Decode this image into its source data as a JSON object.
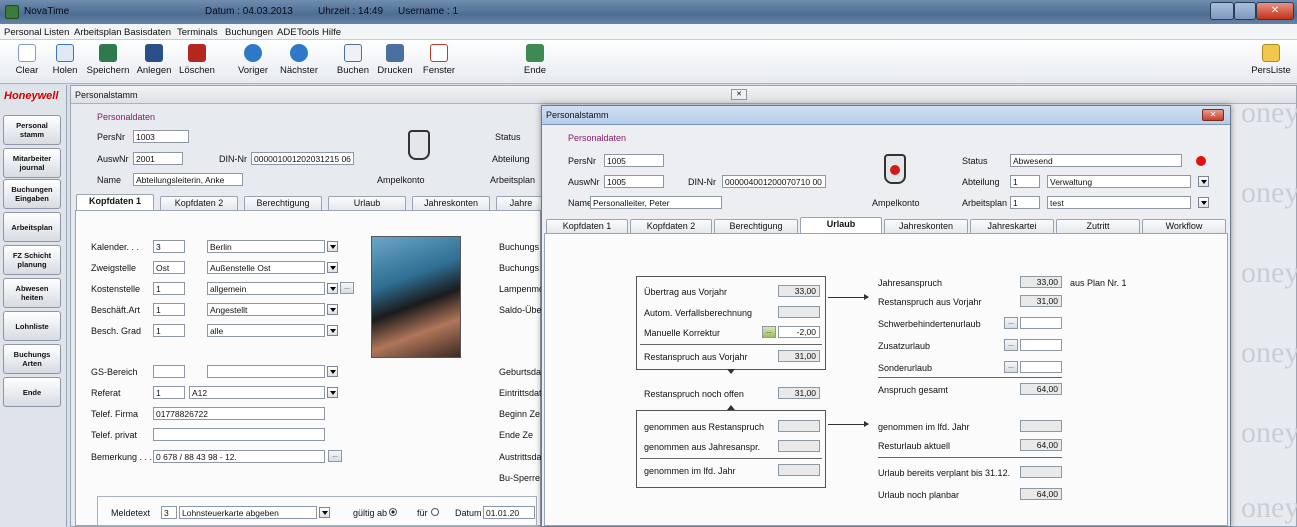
{
  "titlebar": {
    "app": "NovaTime",
    "date": "Datum : 04.03.2013",
    "time": "Uhrzeit : 14:49",
    "user": "Username : 1"
  },
  "menu": [
    "Personal",
    "Listen",
    "Arbeitsplan",
    "Basisdaten",
    "Terminals",
    "Buchungen",
    "ADE",
    "Tools",
    "Hilfe"
  ],
  "toolbar": [
    "Clear",
    "Holen",
    "Speichern",
    "Anlegen",
    "Löschen",
    "Voriger",
    "Nächster",
    "Buchen",
    "Drucken",
    "Fenster",
    "Ende"
  ],
  "toolbar_right": "PersListe",
  "sidebar": {
    "logo": "Honeywell",
    "buttons": [
      "Personal stamm",
      "Mitarbeiter journal",
      "Buchungen Eingaben",
      "Arbeitsplan",
      "FZ Schicht planung",
      "Abwesen heiten",
      "Lohnliste",
      "Buchungs Arten",
      "Ende"
    ]
  },
  "back": {
    "title": "Personalstamm",
    "section": "Personaldaten",
    "persnr_label": "PersNr",
    "persnr": "1003",
    "auswnr_label": "AuswNr",
    "auswnr": "2001",
    "din_label": "DIN-Nr",
    "din": "000001001202031215 06",
    "name_label": "Name",
    "name": "Abteilungsleiterin, Anke",
    "ampel": "Ampelkonto",
    "status_label": "Status",
    "abteilung_label": "Abteilung",
    "arbeitsplan_label": "Arbeitsplan",
    "tabs": [
      "Kopfdaten 1",
      "Kopfdaten 2",
      "Berechtigung",
      "Urlaub",
      "Jahreskonten",
      "Jahre"
    ],
    "fields": [
      {
        "label": "Kalender. . .",
        "code": "3",
        "value": "Berlin"
      },
      {
        "label": "Zweigstelle",
        "code": "Ost",
        "value": "Außenstelle Ost"
      },
      {
        "label": "Kostenstelle",
        "code": "1",
        "value": "allgemein"
      },
      {
        "label": "Beschäft.Art",
        "code": "1",
        "value": "Angestellt"
      },
      {
        "label": "Besch. Grad",
        "code": "1",
        "value": "alle"
      }
    ],
    "gs_label": "GS-Bereich",
    "referat_label": "Referat",
    "referat_code": "1",
    "referat_value": "A12",
    "firma_label": "Telef. Firma",
    "firma": "01778826722",
    "privat_label": "Telef. privat",
    "privat": "",
    "bem_label": "Bemerkung . . .",
    "bem": "0 678 / 88 43 98 - 12.",
    "right_labels": [
      "Buchungs",
      "Buchungs",
      "Lampenmo",
      "Saldo-Übe"
    ],
    "right_labels2": [
      "Geburtsda",
      "Eintrittsdat",
      "Beginn Ze",
      "Ende Ze",
      "Austrittsda",
      "Bu-Sperre"
    ],
    "meldetext_label": "Meldetext",
    "meldetext_code": "3",
    "meldetext": "Lohnsteuerkarte abgeben",
    "gueltig": "gültig ab",
    "fuer": "für",
    "datum_label": "Datum",
    "datum": "01.01.20"
  },
  "front": {
    "title": "Personalstamm",
    "section": "Personaldaten",
    "persnr_label": "PersNr",
    "persnr": "1005",
    "auswnr_label": "AuswNr",
    "auswnr": "1005",
    "din_label": "DIN-Nr",
    "din": "000004001200070710 00",
    "name_label": "Name",
    "name": "Personalleiter, Peter",
    "ampel": "Ampelkonto",
    "status_label": "Status",
    "status": "Abwesend",
    "abteilung_label": "Abteilung",
    "abteilung_code": "1",
    "abteilung": "Verwaltung",
    "arbeitsplan_label": "Arbeitsplan",
    "arbeitsplan_code": "1",
    "arbeitsplan": "test",
    "tabs": [
      "Kopfdaten 1",
      "Kopfdaten 2",
      "Berechtigung",
      "Urlaub",
      "Jahreskonten",
      "Jahreskartei",
      "Zutritt",
      "Workflow"
    ],
    "left": {
      "uebertrag_label": "Übertrag aus Vorjahr",
      "uebertrag": "33,00",
      "autom_label": "Autom. Verfallsberechnung",
      "manuell_label": "Manuelle Korrektur",
      "manuell": "-2,00",
      "rest_label": "Restanspruch aus Vorjahr",
      "rest": "31,00",
      "offen_label": "Restanspruch noch offen",
      "offen": "31,00",
      "gen_rest_label": "genommen aus Restanspruch",
      "gen_jahr_label": "genommen aus Jahresanspr.",
      "gen_lfd_label": "genommen im lfd. Jahr"
    },
    "right": {
      "jahres_label": "Jahresanspruch",
      "jahres": "33,00",
      "plan_note": "aus Plan Nr. 1",
      "restvj_label": "Restanspruch aus Vorjahr",
      "restvj": "31,00",
      "schwer_label": "Schwerbehindertenurlaub",
      "zusatz_label": "Zusatzurlaub",
      "sonder_label": "Sonderurlaub",
      "gesamt_label": "Anspruch gesamt",
      "gesamt": "64,00",
      "genlfd_label": "genommen im lfd. Jahr",
      "rest_akt_label": "Resturlaub aktuell",
      "rest_akt": "64,00",
      "verplant_label": "Urlaub bereits verplant bis 31.12.",
      "planbar_label": "Urlaub noch planbar",
      "planbar": "64,00"
    }
  },
  "watermark": "oney"
}
